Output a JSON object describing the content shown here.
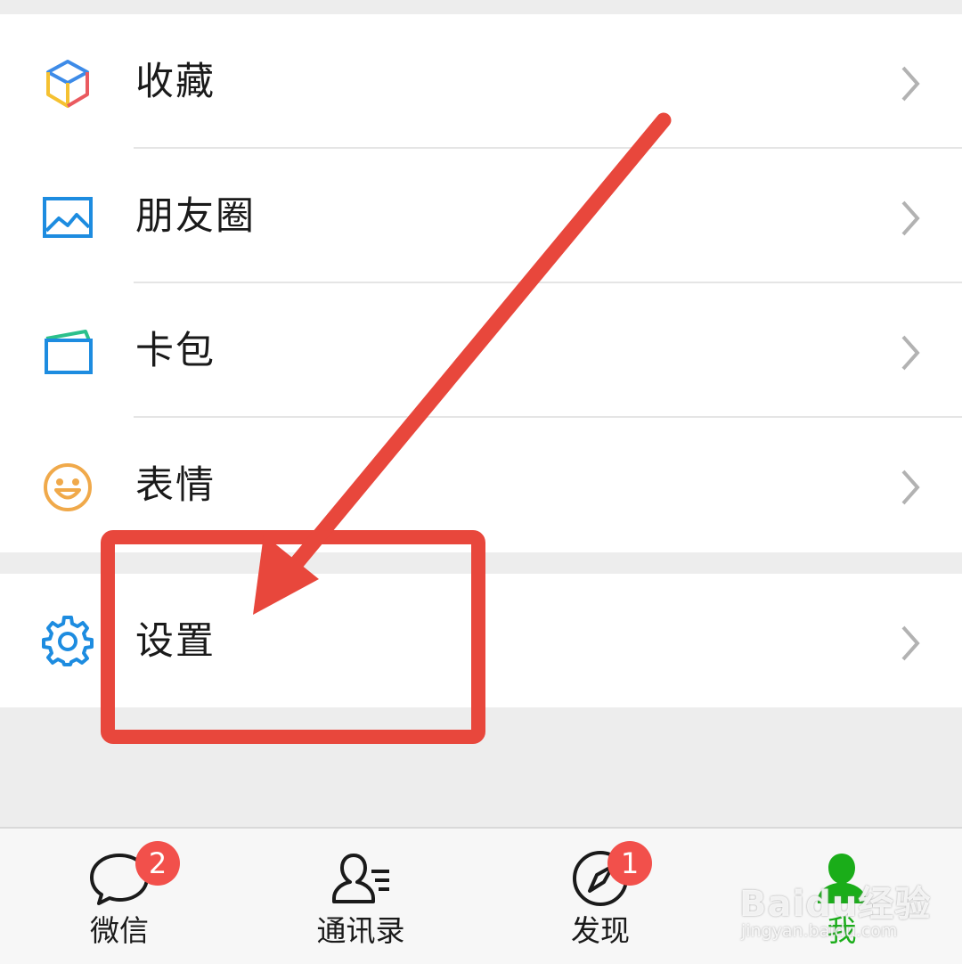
{
  "menu": {
    "items": [
      {
        "label": "收藏",
        "icon": "favorites-cube-icon"
      },
      {
        "label": "朋友圈",
        "icon": "moments-picture-icon"
      },
      {
        "label": "卡包",
        "icon": "card-wallet-icon"
      },
      {
        "label": "表情",
        "icon": "smiley-sticker-icon"
      }
    ],
    "settings": {
      "label": "设置",
      "icon": "gear-icon"
    }
  },
  "tabbar": {
    "tabs": [
      {
        "label": "微信",
        "icon": "chat-bubble-icon",
        "badge": "2"
      },
      {
        "label": "通讯录",
        "icon": "contacts-icon",
        "badge": ""
      },
      {
        "label": "发现",
        "icon": "discover-compass-icon",
        "badge": "1"
      },
      {
        "label": "我",
        "icon": "me-person-icon",
        "badge": "",
        "active": true
      }
    ]
  },
  "annotation": {
    "color": "#e8473c",
    "target": "设置"
  },
  "watermark": {
    "text": "Baidu经验",
    "url": "jingyan.baidu.com"
  },
  "colors": {
    "active_tab": "#1aad19",
    "badge": "#f2504b",
    "icon_blue": "#1d8ce0"
  }
}
